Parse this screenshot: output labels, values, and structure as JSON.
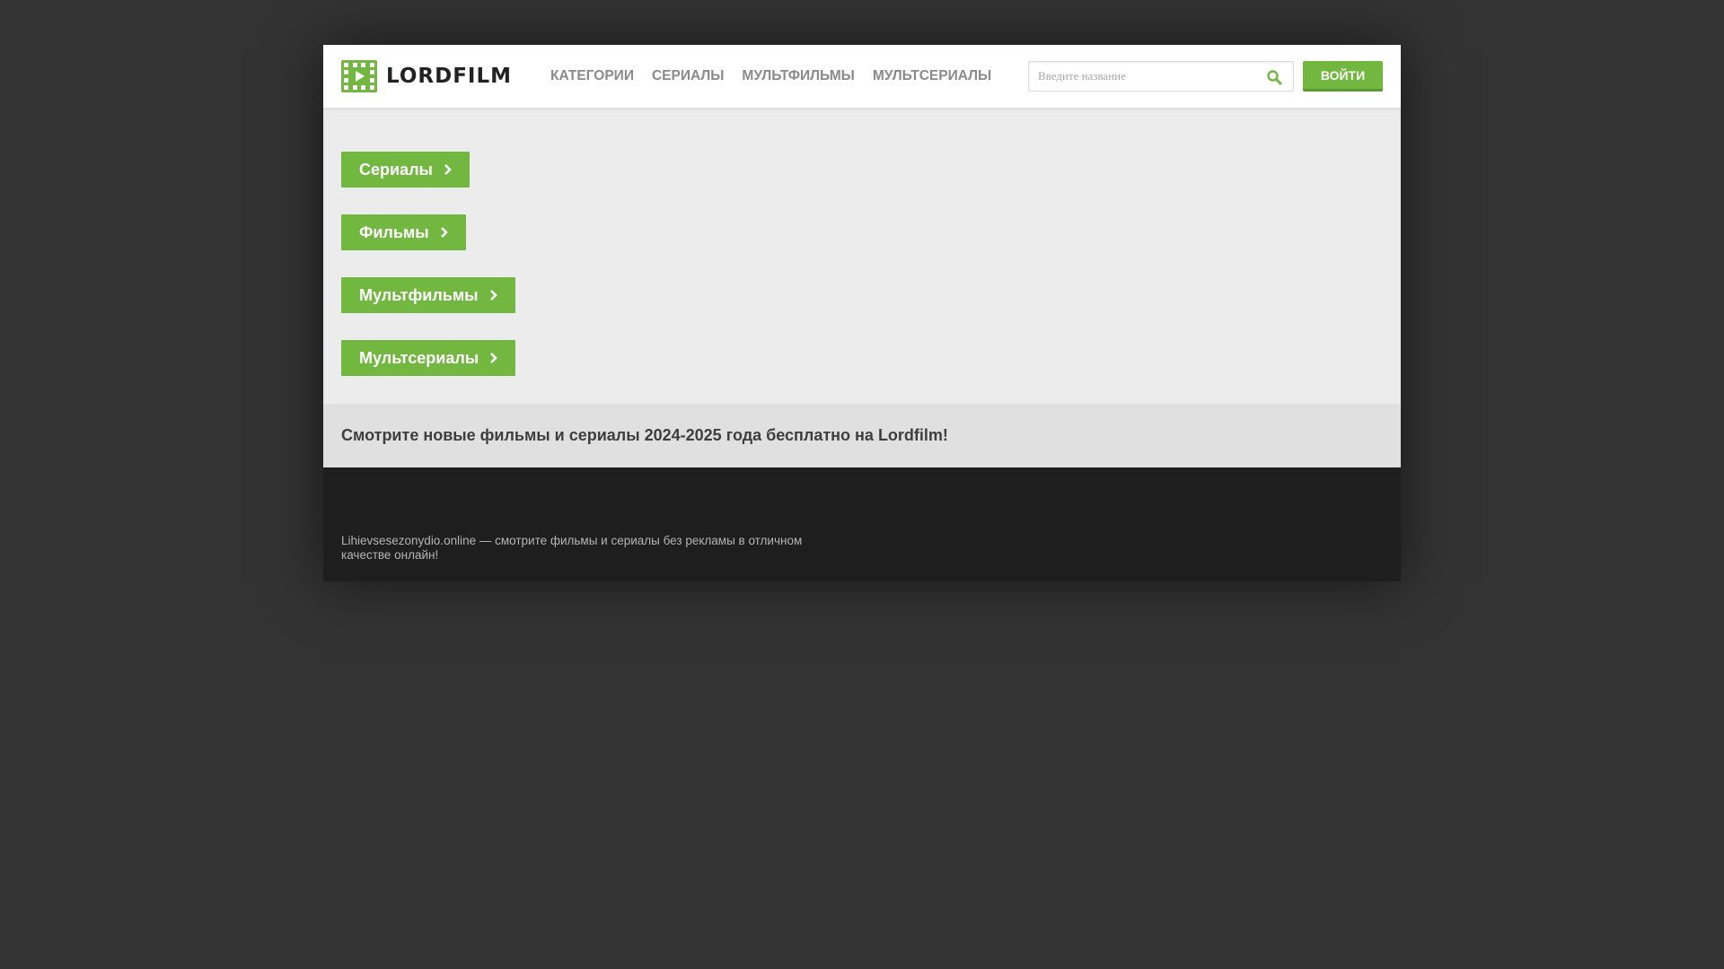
{
  "header": {
    "logo_text": "LORDFILM",
    "nav": [
      {
        "label": "КАТЕГОРИИ"
      },
      {
        "label": "СЕРИАЛЫ"
      },
      {
        "label": "МУЛЬТФИЛЬМЫ"
      },
      {
        "label": "МУЛЬТСЕРИАЛЫ"
      }
    ],
    "search": {
      "placeholder": "Введите название",
      "value": ""
    },
    "login_label": "ВОЙТИ"
  },
  "categories": [
    {
      "label": "Сериалы"
    },
    {
      "label": "Фильмы"
    },
    {
      "label": "Мультфильмы"
    },
    {
      "label": "Мультсериалы"
    }
  ],
  "tagline": "Смотрите новые фильмы и сериалы 2024-2025 года бесплатно на Lordfilm!",
  "footer": {
    "text": "Lihievsesezonydio.online — смотрите фильмы и сериалы без рекламы в отличном качестве онлайн!"
  },
  "colors": {
    "accent": "#71b740",
    "page_background": "#333333",
    "footer_background": "#1e1e1e"
  },
  "icons": {
    "logo": "film-strip-play-icon",
    "search": "search-icon",
    "category_arrow": "chevron-right-icon"
  }
}
